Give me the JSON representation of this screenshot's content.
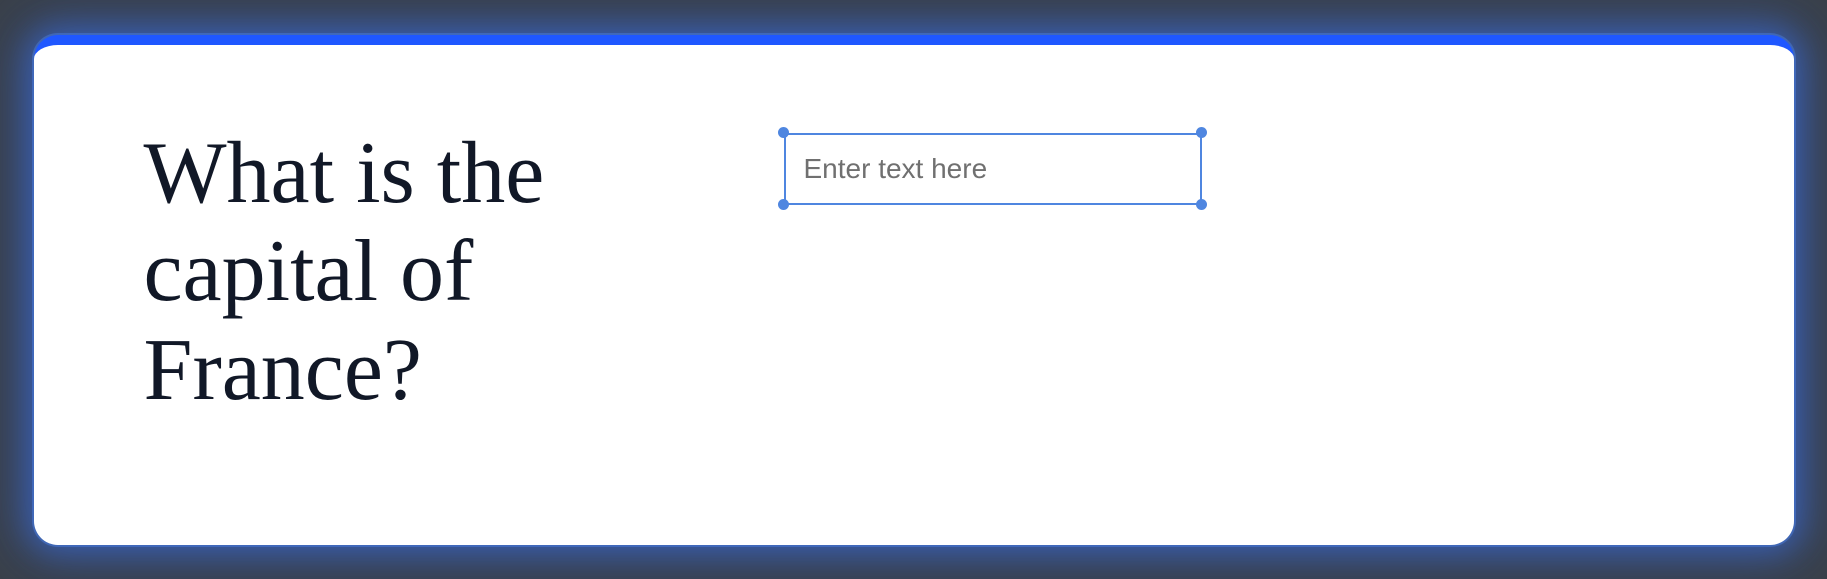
{
  "card": {
    "accent_color": "#1f57ff",
    "question": "What is the capital of France?",
    "answer": {
      "placeholder": "Enter text here",
      "value": ""
    }
  }
}
